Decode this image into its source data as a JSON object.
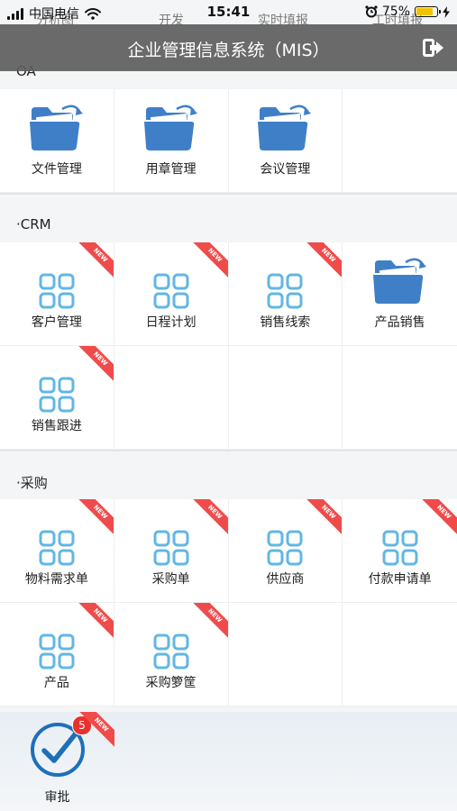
{
  "status_bar": {
    "carrier": "中国电信",
    "time": "15:41",
    "battery_percent": "75%",
    "battery_level": 0.75
  },
  "header_ghost": [
    "分析图",
    "开发",
    "实时填报",
    "工时填报"
  ],
  "header": {
    "title": "企业管理信息系统（MIS）"
  },
  "sections": [
    {
      "title": "OA",
      "items": [
        {
          "label": "文件管理",
          "icon": "folder-icon",
          "new": false
        },
        {
          "label": "用章管理",
          "icon": "folder-icon",
          "new": false
        },
        {
          "label": "会议管理",
          "icon": "folder-icon",
          "new": false
        }
      ]
    },
    {
      "title": "·CRM",
      "items": [
        {
          "label": "客户管理",
          "icon": "grid-icon",
          "new": true
        },
        {
          "label": "日程计划",
          "icon": "grid-icon",
          "new": true
        },
        {
          "label": "销售线索",
          "icon": "grid-icon",
          "new": true
        },
        {
          "label": "产品销售",
          "icon": "folder-icon",
          "new": false
        },
        {
          "label": "销售跟进",
          "icon": "grid-icon",
          "new": true
        }
      ]
    },
    {
      "title": "·采购",
      "items": [
        {
          "label": "物料需求单",
          "icon": "grid-icon",
          "new": true
        },
        {
          "label": "采购单",
          "icon": "grid-icon",
          "new": true
        },
        {
          "label": "供应商",
          "icon": "grid-icon",
          "new": true
        },
        {
          "label": "付款申请单",
          "icon": "grid-icon",
          "new": true
        },
        {
          "label": "产品",
          "icon": "grid-icon",
          "new": true
        },
        {
          "label": "采购箩筐",
          "icon": "grid-icon",
          "new": true
        }
      ]
    }
  ],
  "ribbon_text": "NEW",
  "bottom": {
    "label": "审批",
    "badge": "5",
    "icon": "check-circle-icon",
    "new": true
  },
  "colors": {
    "folder": "#3f7fc8",
    "grid_icon": "#62b7e3",
    "ribbon": "#f04b4b",
    "badge": "#e8322f",
    "check": "#1e6fba"
  }
}
